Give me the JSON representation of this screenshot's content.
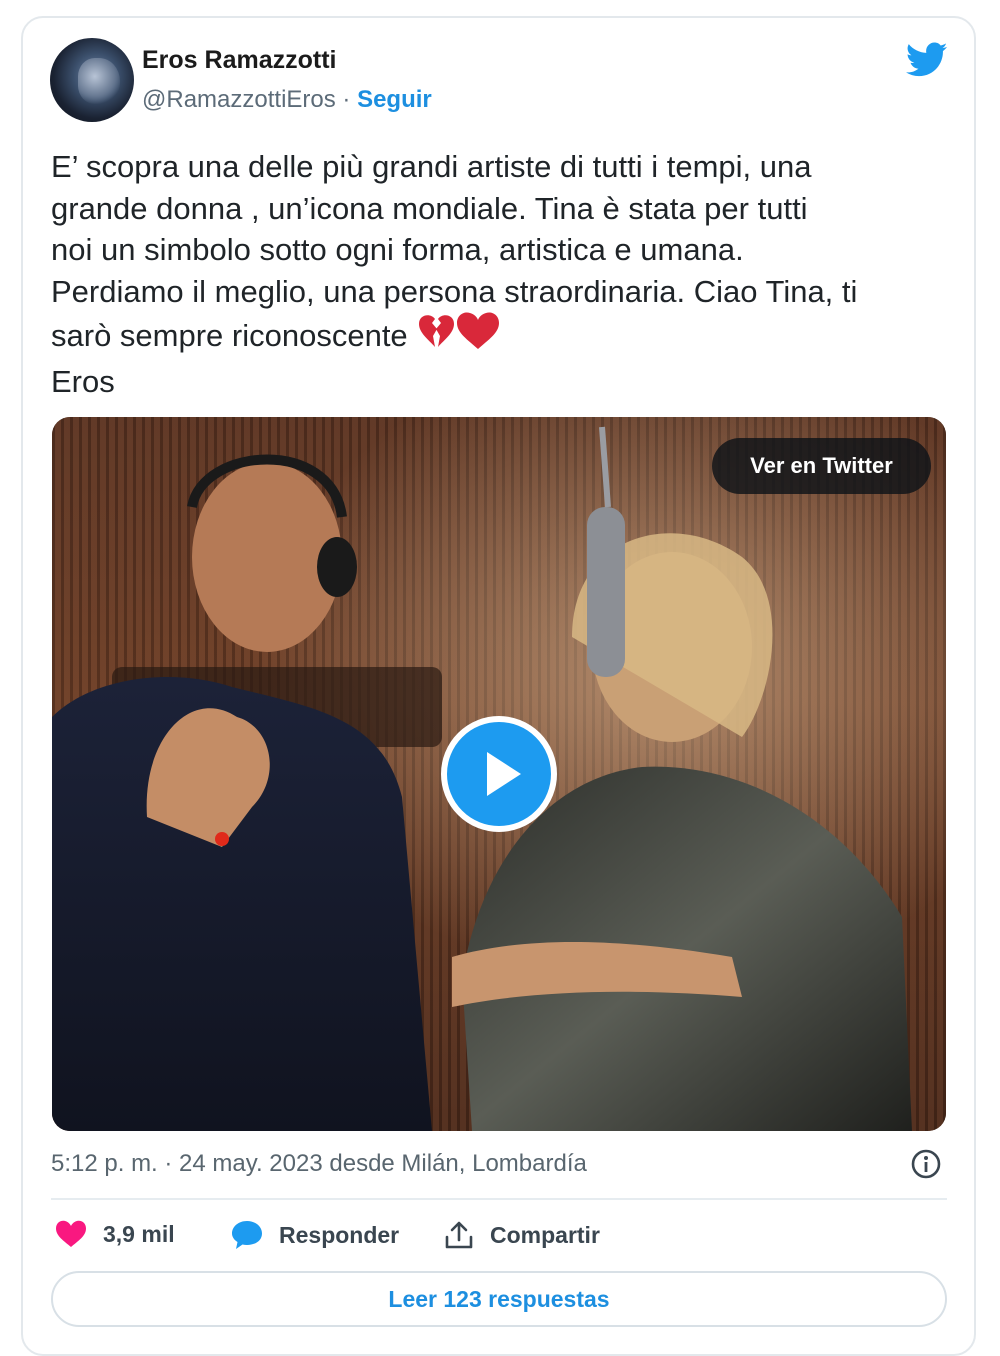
{
  "author": {
    "name": "Eros Ramazzotti",
    "handle": "@RamazzottiEros",
    "separator": " · ",
    "follow_label": "Seguir"
  },
  "tweet": {
    "text": "E’ scopra una delle più  grandi artiste di tutti i tempi, una\ngrande donna , un’icona mondiale. Tina è stata per tutti\nnoi un simbolo sotto ogni forma, artistica e umana.\nPerdiamo il meglio, una persona straordinaria. Ciao Tina, ti\nsarò sempre riconoscente ",
    "signature": "Eros",
    "emojis": [
      "broken-heart-icon",
      "red-heart-icon"
    ]
  },
  "media": {
    "watch_label": "Ver en Twitter",
    "play_icon": "play-icon"
  },
  "meta": {
    "timestamp": "5:12 p. m. · 24 may. 2023 desde Milán, Lombardía"
  },
  "actions": {
    "likes": "3,9 mil",
    "reply_label": "Responder",
    "share_label": "Compartir"
  },
  "read_replies_label": "Leer 123 respuestas",
  "colors": {
    "accent": "#1d9bf0",
    "like": "#f91880",
    "text": "#1f2428",
    "muted": "#59666f"
  }
}
